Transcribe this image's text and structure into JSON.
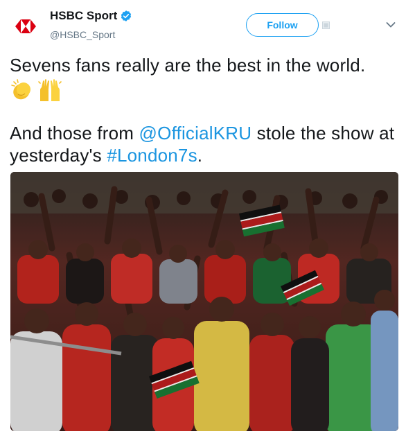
{
  "account": {
    "display_name": "HSBC Sport",
    "handle": "@HSBC_Sport",
    "verified": true,
    "logo_icon": "hsbc-logo-icon"
  },
  "actions": {
    "follow_label": "Follow",
    "menu_icon": "chevron-down-icon"
  },
  "tweet": {
    "line1": "Sevens fans really are the best in the world.",
    "emojis": [
      "clapping-hands-emoji",
      "raising-hands-emoji"
    ],
    "text_before_mention": "And those from ",
    "mention": "@OfficialKRU",
    "text_after_mention": " stole the show at yesterday's ",
    "hashtag": "#London7s",
    "text_end": "."
  },
  "media": {
    "photo_icon": "crowd-photo"
  },
  "colors": {
    "link": "#1b95e0",
    "follow": "#1da1f2",
    "verified": "#1da1f2",
    "hsbc_red": "#db0011"
  }
}
